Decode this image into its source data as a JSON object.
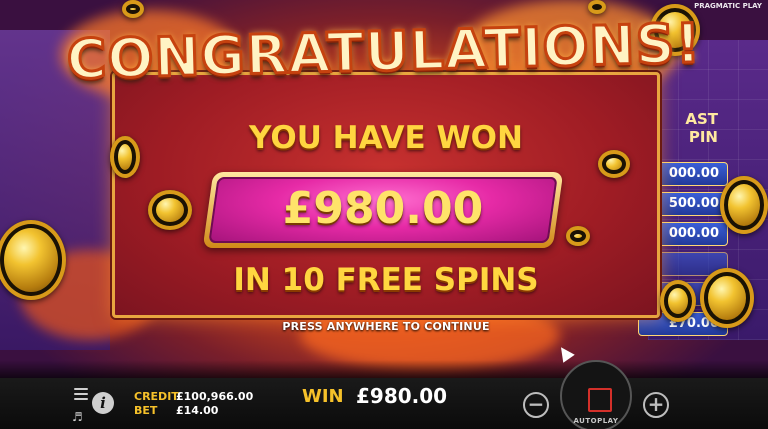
{
  "popup": {
    "title": "CONGRATULATIONS!",
    "won_label": "YOU HAVE WON",
    "amount": "£980.00",
    "spins_label": "IN 10 FREE SPINS",
    "continue_hint": "PRESS ANYWHERE TO CONTINUE"
  },
  "brand": "PRAGMATIC PLAY",
  "paytable": {
    "header": "AST\nPIN",
    "rows": [
      "000.00",
      "500.00",
      "000.00",
      "",
      "",
      "£70.00"
    ]
  },
  "bottom_bar": {
    "credit_label": "CREDIT",
    "credit_value": "£100,966.00",
    "bet_label": "BET",
    "bet_value": "£14.00",
    "win_label": "WIN",
    "win_value": "£980.00",
    "autoplay_label": "AUTOPLAY",
    "minus_symbol": "−",
    "plus_symbol": "+",
    "info_symbol": "i"
  },
  "colors": {
    "accent_yellow": "#f6c12a",
    "panel_red": "#9e1c24",
    "amount_pink": "#e62aa6",
    "spin_red": "#d4302a"
  },
  "icons": [
    "menu-icon",
    "sound-icon",
    "info-icon",
    "minus-icon",
    "plus-icon",
    "spin-icon"
  ]
}
